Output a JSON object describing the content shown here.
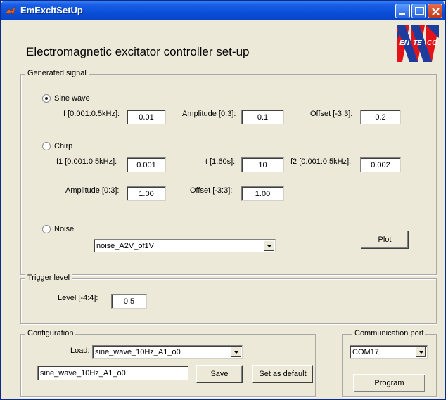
{
  "window": {
    "title": "EmExcitSetUp"
  },
  "heading": "Electromagnetic excitator controller set-up",
  "logo": {
    "letters": [
      "EN",
      "TE",
      "CO"
    ],
    "accent": "#e2141a",
    "brand": "#1d3d9e"
  },
  "generated_signal": {
    "legend": "Generated signal",
    "sine": {
      "label": "Sine wave",
      "selected": true,
      "f_label": "f [0.001:0.5kHz]:",
      "f_value": "0.01",
      "amp_label": "Amplitude [0:3]:",
      "amp_value": "0.1",
      "offset_label": "Offset [-3:3]:",
      "offset_value": "0.2"
    },
    "chirp": {
      "label": "Chirp",
      "selected": false,
      "f1_label": "f1 [0.001:0.5kHz]:",
      "f1_value": "0.001",
      "t_label": "t [1:60s]:",
      "t_value": "10",
      "f2_label": "f2 [0.001:0.5kHz]:",
      "f2_value": "0.002",
      "amp_label": "Amplitude [0:3]:",
      "amp_value": "1.00",
      "offset_label": "Offset [-3:3]:",
      "offset_value": "1.00"
    },
    "noise": {
      "label": "Noise",
      "selected": false,
      "file": "noise_A2V_of1V"
    },
    "plot_button": "Plot"
  },
  "trigger": {
    "legend": "Trigger level",
    "level_label": "Level [-4:4]:",
    "level_value": "0.5"
  },
  "configuration": {
    "legend": "Configuration",
    "load_label": "Load:",
    "load_value": "sine_wave_10Hz_A1_o0",
    "name_value": "sine_wave_10Hz_A1_o0",
    "save_button": "Save",
    "default_button": "Set as default"
  },
  "communication": {
    "legend": "Communication port",
    "port_value": "COM17",
    "program_button": "Program"
  }
}
